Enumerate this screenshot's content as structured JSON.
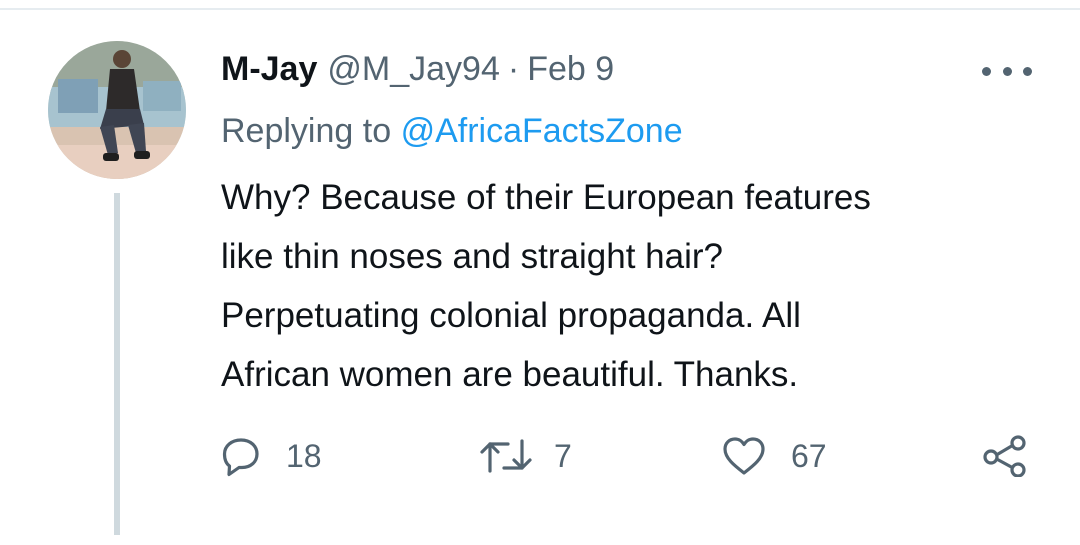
{
  "tweet": {
    "display_name": "M-Jay",
    "handle": "@M_Jay94",
    "separator": "·",
    "date": "Feb 9",
    "replying_prefix": "Replying to",
    "replying_to": "@AfricaFactsZone",
    "text_lines": [
      "Why? Because of their European features",
      "like thin noses and straight hair?",
      "Perpetuating colonial propaganda. All",
      "African women are beautiful. Thanks."
    ]
  },
  "actions": {
    "reply_count": "18",
    "retweet_count": "7",
    "like_count": "67"
  },
  "icons": {
    "reply": "reply-icon",
    "retweet": "retweet-icon",
    "like": "heart-icon",
    "share": "share-icon",
    "more": "more-options-icon"
  },
  "colors": {
    "text": "#0f1419",
    "secondary": "#536471",
    "link": "#1d9bf0",
    "thread_line": "#cfd9de"
  }
}
